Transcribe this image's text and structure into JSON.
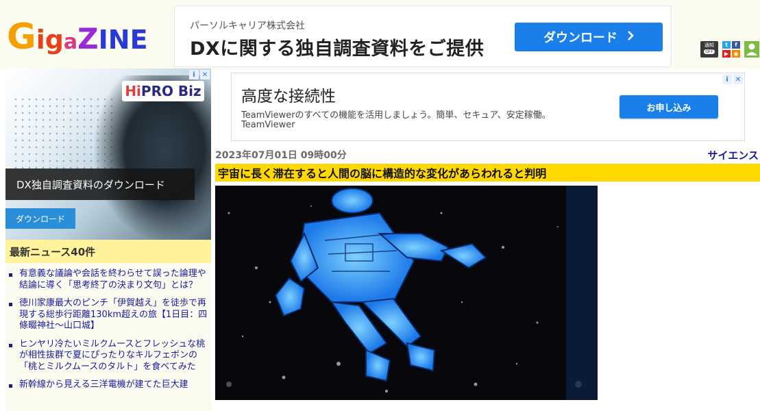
{
  "header": {
    "logo_letters": [
      "G",
      "i",
      "g",
      "a",
      "Z",
      "I",
      "N",
      "E"
    ],
    "logo_colors": [
      "#f5a000",
      "#e8401c",
      "#e8401c",
      "#d83a8a",
      "#9a2ad8",
      "#2a3ad8",
      "#2a3ad8",
      "#2a3ad8"
    ],
    "notify_label": "通知",
    "notify_state": "OFF",
    "icons": [
      "twitter-icon",
      "facebook-icon",
      "youtube-icon",
      "rss-icon",
      "user-icon"
    ]
  },
  "top_ad": {
    "company": "パーソルキャリア株式会社",
    "headline": "DXに関する独自調査資料をご提供",
    "button_label": "ダウンロード",
    "button_color": "#1a7fe8"
  },
  "left_ad": {
    "brand_hi": "Hi",
    "brand_rest": "PRO Biz",
    "caption": "DX独自調査資料のダウンロード",
    "button_label": "ダウンロード"
  },
  "news": {
    "heading": "最新ニュース40件",
    "items": [
      "有意義な議論や会話を終わらせて誤った論理や結論に導く「思考終了の決まり文句」とは？",
      "徳川家康最大のピンチ「伊賀越え」を徒歩で再現する総歩行距離130km超えの旅【1日目：四條畷神社～山口城】",
      "ヒンヤリ冷たいミルクムースとフレッシュな桃が相性抜群で夏にぴったりなキルフェボンの「桃とミルクムースのタルト」を食べてみた",
      "新幹線から見える三洋電機が建てた巨大建"
    ]
  },
  "main_ad": {
    "title": "高度な接続性",
    "description": "TeamViewerのすべての機能を活用しましょう。簡単、セキュア、安定稼働。",
    "brand": "TeamViewer",
    "button_label": "お申し込み"
  },
  "article": {
    "date": "2023年07月01日 09時00分",
    "category": "サイエンス",
    "title": "宇宙に長く滞在すると人間の脳に構造的な変化があらわれると判明",
    "title_bg": "#ffd800"
  },
  "ad_choices": {
    "info": "i",
    "close": "✕"
  }
}
